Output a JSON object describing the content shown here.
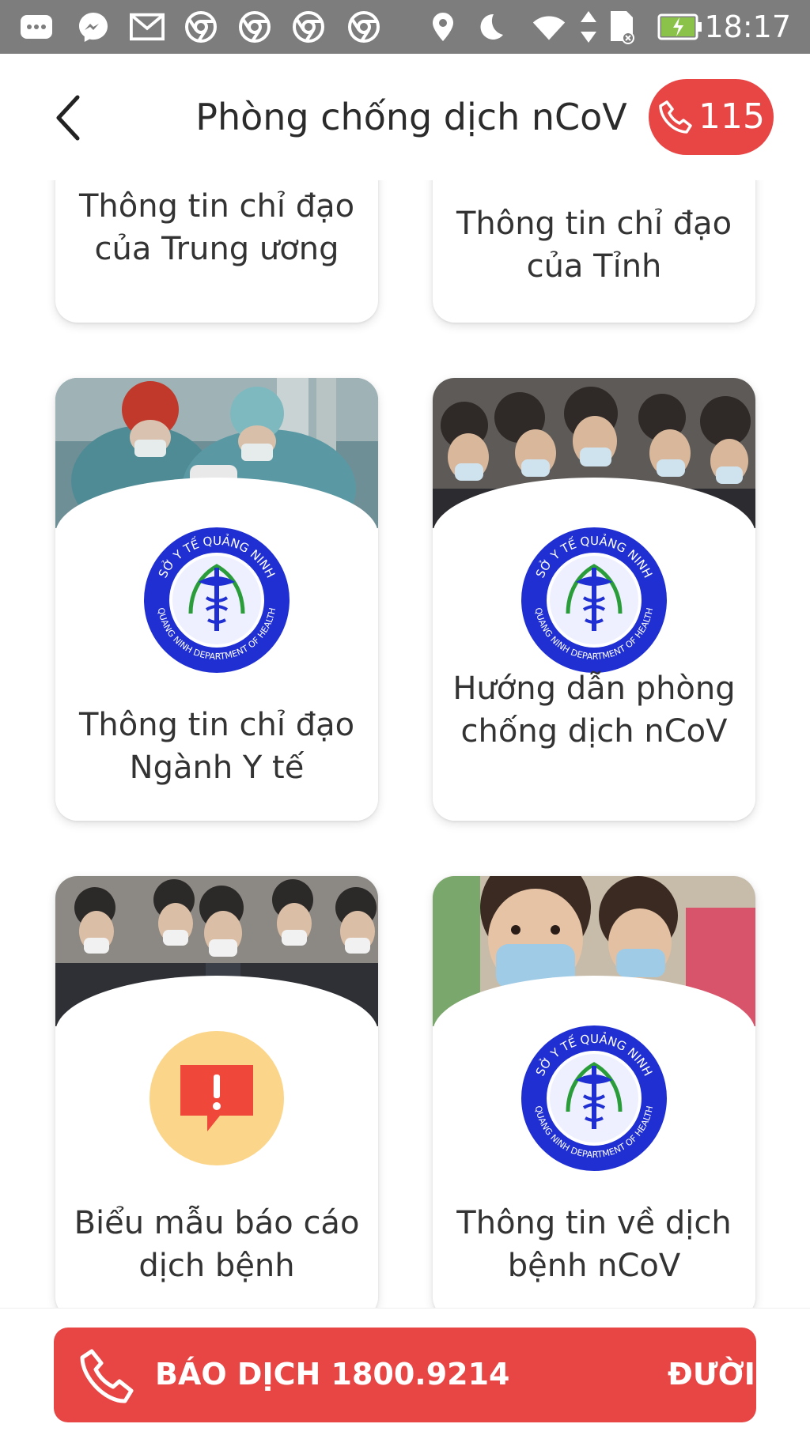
{
  "status_bar": {
    "time": "18:17",
    "left_icons": [
      "sms-icon",
      "messenger-icon",
      "gmail-icon",
      "chrome-icon",
      "chrome-icon",
      "chrome-icon",
      "chrome-icon"
    ],
    "right_icons": [
      "location-icon",
      "do-not-disturb-moon-icon",
      "wifi-icon",
      "data-arrows-icon",
      "sd-card-icon",
      "battery-charging-icon"
    ]
  },
  "header": {
    "title": "Phòng chống dịch nCoV",
    "hotline_label": "115",
    "accent_color": "#e84545"
  },
  "cards": [
    {
      "label": "Thông tin chỉ đạo của Trung ương"
    },
    {
      "label": "Thông tin chỉ đạo của Tỉnh"
    },
    {
      "label": "Thông tin chỉ đạo Ngành Y tế",
      "photo": "surgeons-photo",
      "icon": "health-department-seal-icon",
      "seal_text_top": "SỞ Y TẾ QUẢNG NINH",
      "seal_text_bottom": "QUANG NINH DEPARTMENT OF HEALTH"
    },
    {
      "label": "Hướng dẫn phòng chống dịch nCoV",
      "photo": "masked-crowd-photo",
      "icon": "health-department-seal-icon",
      "seal_text_top": "SỞ Y TẾ QUẢNG NINH",
      "seal_text_bottom": "QUANG NINH DEPARTMENT OF HEALTH"
    },
    {
      "label": "Biểu mẫu báo cáo dịch bệnh",
      "photo": "masked-commuters-photo",
      "icon": "alert-report-icon"
    },
    {
      "label": "Thông tin về dịch bệnh nCoV",
      "photo": "masked-children-photo",
      "icon": "health-department-seal-icon",
      "seal_text_top": "SỞ Y TẾ QUẢNG NINH",
      "seal_text_bottom": "QUANG NINH DEPARTMENT OF HEALTH"
    }
  ],
  "ticker": {
    "text_main": "BÁO DỊCH 1800.9214",
    "text_next": "ĐƯỜI",
    "icon": "phone-icon"
  }
}
